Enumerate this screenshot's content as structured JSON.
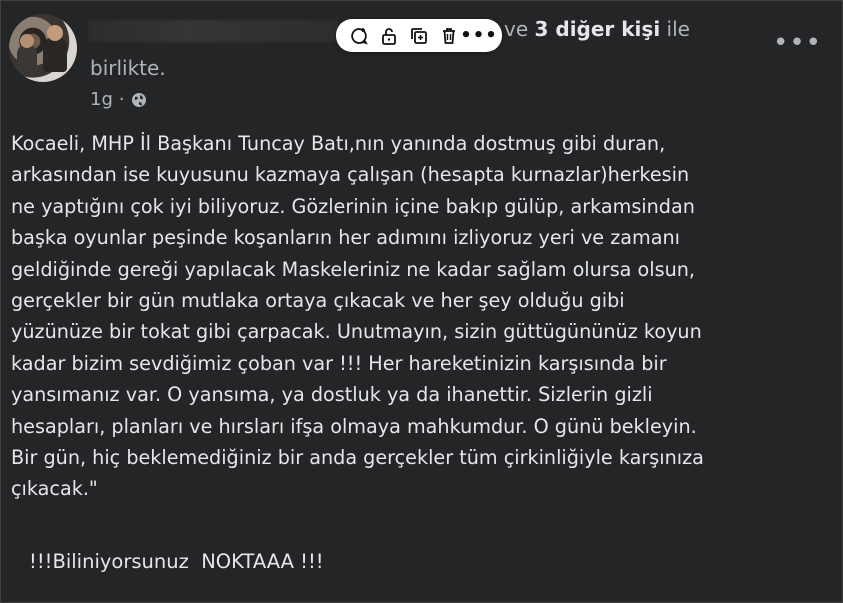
{
  "post": {
    "header_suffix_prefix": "ve ",
    "header_bold": "3 diğer kişi",
    "header_suffix": " ile",
    "header_line2": "birlikte.",
    "timestamp": "1g",
    "separator": "·",
    "privacy_icon": "globe-icon",
    "more_icon": "more-horizontal-icon"
  },
  "toolbar": {
    "icons": [
      "comment-add-icon",
      "unlock-icon",
      "copy-icon",
      "trash-icon",
      "more-horizontal-icon"
    ],
    "more_label": "•••"
  },
  "content": {
    "body": "Kocaeli, MHP İl Başkanı Tuncay Batı,nın yanında dostmuş gibi duran,\narkasından  ise kuyusunu kazmaya çalışan (hesapta kurnazlar)herkesin\nne yaptığını çok iyi biliyoruz. Gözlerinin içine bakıp gülüp, arkamsindan\nbaşka oyunlar peşinde koşanların her adımını izliyoruz yeri ve zamanı\ngeldiğinde gereği yapılacak  Maskeleriniz ne kadar sağlam olursa olsun,\ngerçekler bir gün mutlaka ortaya çıkacak ve her şey olduğu gibi\nyüzünüze bir tokat gibi çarpacak. Unutmayın, sizin güttügününüz koyun\nkadar bizim sevdiğimiz çoban var !!! Her hareketinizin karşısında bir\nyansımanız var. O yansıma, ya dostluk ya da ihanettir. Sizlerin gizli\nhesapları, planları ve hırsları ifşa olmaya mahkumdur. O günü bekleyin.\nBir gün, hiç beklemediğiniz bir anda gerçekler tüm çirkinliğiyle karşınıza\nçıkacak.\"",
    "footer": "!!!Biliniyorsunuz  NOKTAAA !!!"
  },
  "colors": {
    "background": "#242526",
    "primary_text": "#e4e6eb",
    "secondary_text": "#b0b3b8",
    "toolbar_bg": "#ffffff"
  }
}
